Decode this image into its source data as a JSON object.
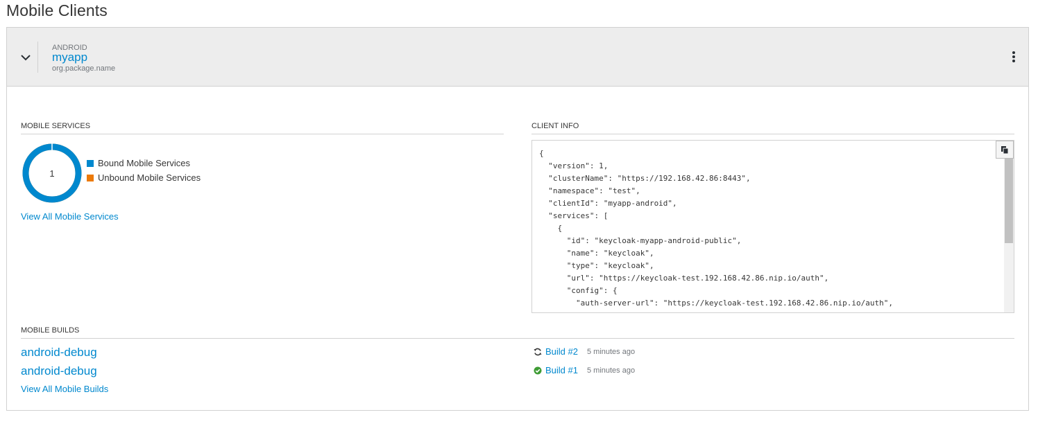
{
  "page": {
    "title": "Mobile Clients"
  },
  "client": {
    "platform": "ANDROID",
    "name": "myapp",
    "package": "org.package.name"
  },
  "mobile_services": {
    "title": "MOBILE SERVICES",
    "count": "1",
    "bound_fraction": 1.0,
    "legend": [
      {
        "label": "Bound Mobile Services",
        "color": "#0088ce"
      },
      {
        "label": "Unbound Mobile Services",
        "color": "#ec7a08"
      }
    ],
    "view_all": "View All Mobile Services"
  },
  "client_info": {
    "title": "CLIENT INFO",
    "json_text": "{\n  \"version\": 1,\n  \"clusterName\": \"https://192.168.42.86:8443\",\n  \"namespace\": \"test\",\n  \"clientId\": \"myapp-android\",\n  \"services\": [\n    {\n      \"id\": \"keycloak-myapp-android-public\",\n      \"name\": \"keycloak\",\n      \"type\": \"keycloak\",\n      \"url\": \"https://keycloak-test.192.168.42.86.nip.io/auth\",\n      \"config\": {\n        \"auth-server-url\": \"https://keycloak-test.192.168.42.86.nip.io/auth\","
  },
  "mobile_builds": {
    "title": "MOBILE BUILDS",
    "builds": [
      {
        "name": "android-debug",
        "build": "Build #2",
        "status": "running",
        "time": "5 minutes ago"
      },
      {
        "name": "android-debug",
        "build": "Build #1",
        "status": "complete",
        "time": "5 minutes ago"
      }
    ],
    "view_all": "View All Mobile Builds"
  },
  "colors": {
    "accent": "#0088ce",
    "success": "#3f9c35",
    "unbound": "#ec7a08"
  }
}
